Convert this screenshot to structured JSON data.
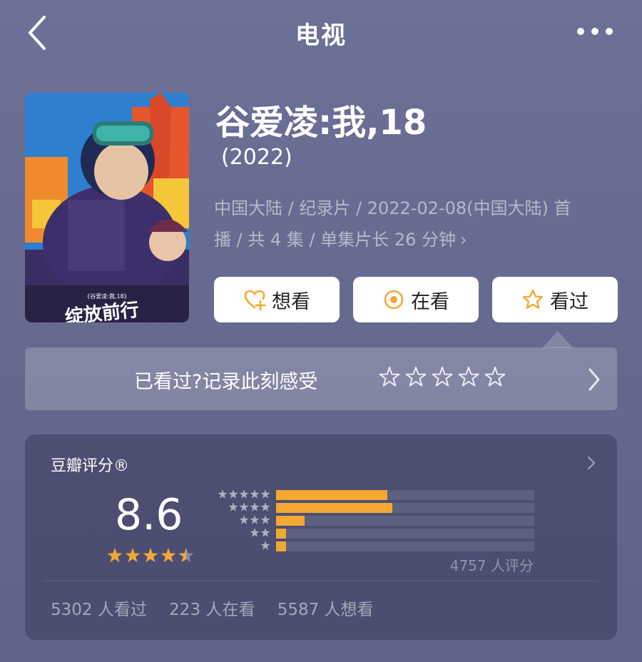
{
  "nav": {
    "title": "电视"
  },
  "poster": {
    "caption": "《谷爱凌:我,18》",
    "slogan": "绽放前行"
  },
  "movie": {
    "title": "谷爱凌:我,18",
    "year": "(2022)",
    "meta_line1": "中国大陆 / 纪录片 / 2022-02-08(中国大陆) 首",
    "meta_line2": "播 / 共 4 集 / 单集片长 26 分钟"
  },
  "actions": {
    "want": "想看",
    "doing": "在看",
    "done": "看过"
  },
  "record": {
    "prompt": "已看过?记录此刻感受"
  },
  "rating": {
    "label": "豆瓣评分®",
    "score": "8.6",
    "score_value": 8.6,
    "distribution_fill": [
      0.43,
      0.45,
      0.11,
      0.04,
      0.04
    ],
    "count": "4757 人评分",
    "stats": [
      "5302 人看过",
      "223 人在看",
      "5587 人想看"
    ]
  },
  "colors": {
    "accent": "#f4a833",
    "background": "#666a8f",
    "button_icon": "#f4a833"
  }
}
